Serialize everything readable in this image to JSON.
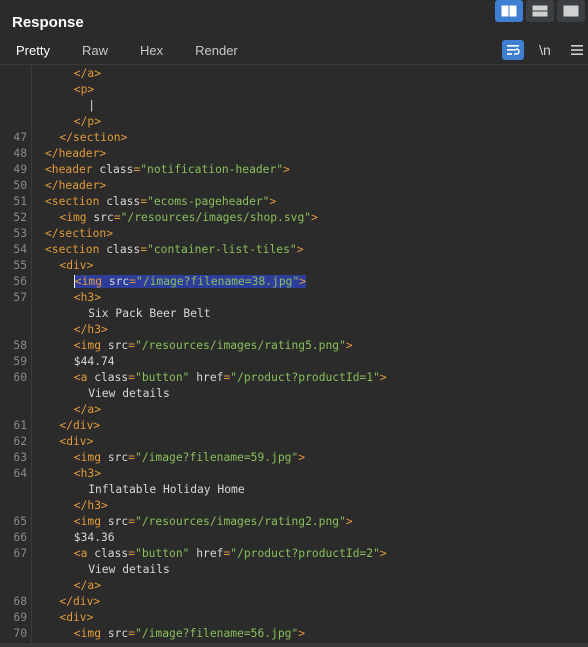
{
  "title": "Response",
  "tabs": [
    {
      "label": "Pretty",
      "active": true
    },
    {
      "label": "Raw",
      "active": false
    },
    {
      "label": "Hex",
      "active": false
    },
    {
      "label": "Render",
      "active": false
    }
  ],
  "toolbar": {
    "newline_label": "\\n"
  },
  "colors": {
    "tag": "#e39a3a",
    "value": "#8bbf5a",
    "selection": "#2f3d9a",
    "active_tab_underline": "#e0703a",
    "accent": "#3f7fd1"
  },
  "lines": [
    {
      "n": "",
      "indent": 5,
      "parts": [
        [
          "tag",
          "</a>"
        ]
      ]
    },
    {
      "n": "",
      "indent": 5,
      "parts": [
        [
          "tag",
          "<p>"
        ]
      ]
    },
    {
      "n": "",
      "indent": 6,
      "parts": [
        [
          "txt",
          "|"
        ]
      ]
    },
    {
      "n": "",
      "indent": 5,
      "parts": [
        [
          "tag",
          "</p>"
        ]
      ]
    },
    {
      "n": "47",
      "indent": 4,
      "parts": [
        [
          "tag",
          "</section>"
        ]
      ]
    },
    {
      "n": "48",
      "indent": 3,
      "parts": [
        [
          "tag",
          "</header>"
        ]
      ]
    },
    {
      "n": "49",
      "indent": 3,
      "parts": [
        [
          "tag",
          "<header "
        ],
        [
          "attr",
          "class"
        ],
        [
          "tag",
          "="
        ],
        [
          "val",
          "\"notification-header\""
        ],
        [
          "tag",
          ">"
        ]
      ]
    },
    {
      "n": "50",
      "indent": 3,
      "parts": [
        [
          "tag",
          "</header>"
        ]
      ]
    },
    {
      "n": "51",
      "indent": 3,
      "parts": [
        [
          "tag",
          "<section "
        ],
        [
          "attr",
          "class"
        ],
        [
          "tag",
          "="
        ],
        [
          "val",
          "\"ecoms-pageheader\""
        ],
        [
          "tag",
          ">"
        ]
      ]
    },
    {
      "n": "52",
      "indent": 4,
      "parts": [
        [
          "tag",
          "<img "
        ],
        [
          "attr",
          "src"
        ],
        [
          "tag",
          "="
        ],
        [
          "val",
          "\"/resources/images/shop.svg\""
        ],
        [
          "tag",
          ">"
        ]
      ]
    },
    {
      "n": "53",
      "indent": 3,
      "parts": [
        [
          "tag",
          "</section>"
        ]
      ]
    },
    {
      "n": "54",
      "indent": 3,
      "parts": [
        [
          "tag",
          "<section "
        ],
        [
          "attr",
          "class"
        ],
        [
          "tag",
          "="
        ],
        [
          "val",
          "\"container-list-tiles\""
        ],
        [
          "tag",
          ">"
        ]
      ]
    },
    {
      "n": "55",
      "indent": 4,
      "parts": [
        [
          "tag",
          "<div>"
        ]
      ]
    },
    {
      "n": "56",
      "indent": 5,
      "selected": true,
      "parts": [
        [
          "tag",
          "<img "
        ],
        [
          "attr",
          "src"
        ],
        [
          "tag",
          "="
        ],
        [
          "val",
          "\"/image?filename=38.jpg\""
        ],
        [
          "tag",
          ">"
        ]
      ]
    },
    {
      "n": "57",
      "indent": 5,
      "parts": [
        [
          "tag",
          "<h3>"
        ]
      ]
    },
    {
      "n": "",
      "indent": 6,
      "parts": [
        [
          "txt",
          "Six Pack Beer Belt"
        ]
      ]
    },
    {
      "n": "",
      "indent": 5,
      "parts": [
        [
          "tag",
          "</h3>"
        ]
      ]
    },
    {
      "n": "58",
      "indent": 5,
      "parts": [
        [
          "tag",
          "<img "
        ],
        [
          "attr",
          "src"
        ],
        [
          "tag",
          "="
        ],
        [
          "val",
          "\"/resources/images/rating5.png\""
        ],
        [
          "tag",
          ">"
        ]
      ]
    },
    {
      "n": "59",
      "indent": 5,
      "parts": [
        [
          "txt",
          "$44.74"
        ]
      ]
    },
    {
      "n": "60",
      "indent": 5,
      "parts": [
        [
          "tag",
          "<a "
        ],
        [
          "attr",
          "class"
        ],
        [
          "tag",
          "="
        ],
        [
          "val",
          "\"button\" "
        ],
        [
          "attr",
          "href"
        ],
        [
          "tag",
          "="
        ],
        [
          "val",
          "\"/product?productId=1\""
        ],
        [
          "tag",
          ">"
        ]
      ]
    },
    {
      "n": "",
      "indent": 6,
      "parts": [
        [
          "txt",
          "View details"
        ]
      ]
    },
    {
      "n": "",
      "indent": 5,
      "parts": [
        [
          "tag",
          "</a>"
        ]
      ]
    },
    {
      "n": "61",
      "indent": 4,
      "parts": [
        [
          "tag",
          "</div>"
        ]
      ]
    },
    {
      "n": "62",
      "indent": 4,
      "parts": [
        [
          "tag",
          "<div>"
        ]
      ]
    },
    {
      "n": "63",
      "indent": 5,
      "parts": [
        [
          "tag",
          "<img "
        ],
        [
          "attr",
          "src"
        ],
        [
          "tag",
          "="
        ],
        [
          "val",
          "\"/image?filename=59.jpg\""
        ],
        [
          "tag",
          ">"
        ]
      ]
    },
    {
      "n": "64",
      "indent": 5,
      "parts": [
        [
          "tag",
          "<h3>"
        ]
      ]
    },
    {
      "n": "",
      "indent": 6,
      "parts": [
        [
          "txt",
          "Inflatable Holiday Home"
        ]
      ]
    },
    {
      "n": "",
      "indent": 5,
      "parts": [
        [
          "tag",
          "</h3>"
        ]
      ]
    },
    {
      "n": "65",
      "indent": 5,
      "parts": [
        [
          "tag",
          "<img "
        ],
        [
          "attr",
          "src"
        ],
        [
          "tag",
          "="
        ],
        [
          "val",
          "\"/resources/images/rating2.png\""
        ],
        [
          "tag",
          ">"
        ]
      ]
    },
    {
      "n": "66",
      "indent": 5,
      "parts": [
        [
          "txt",
          "$34.36"
        ]
      ]
    },
    {
      "n": "67",
      "indent": 5,
      "parts": [
        [
          "tag",
          "<a "
        ],
        [
          "attr",
          "class"
        ],
        [
          "tag",
          "="
        ],
        [
          "val",
          "\"button\" "
        ],
        [
          "attr",
          "href"
        ],
        [
          "tag",
          "="
        ],
        [
          "val",
          "\"/product?productId=2\""
        ],
        [
          "tag",
          ">"
        ]
      ]
    },
    {
      "n": "",
      "indent": 6,
      "parts": [
        [
          "txt",
          "View details"
        ]
      ]
    },
    {
      "n": "",
      "indent": 5,
      "parts": [
        [
          "tag",
          "</a>"
        ]
      ]
    },
    {
      "n": "68",
      "indent": 4,
      "parts": [
        [
          "tag",
          "</div>"
        ]
      ]
    },
    {
      "n": "69",
      "indent": 4,
      "parts": [
        [
          "tag",
          "<div>"
        ]
      ]
    },
    {
      "n": "70",
      "indent": 5,
      "parts": [
        [
          "tag",
          "<img "
        ],
        [
          "attr",
          "src"
        ],
        [
          "tag",
          "="
        ],
        [
          "val",
          "\"/image?filename=56.jpg\""
        ],
        [
          "tag",
          ">"
        ]
      ]
    }
  ]
}
